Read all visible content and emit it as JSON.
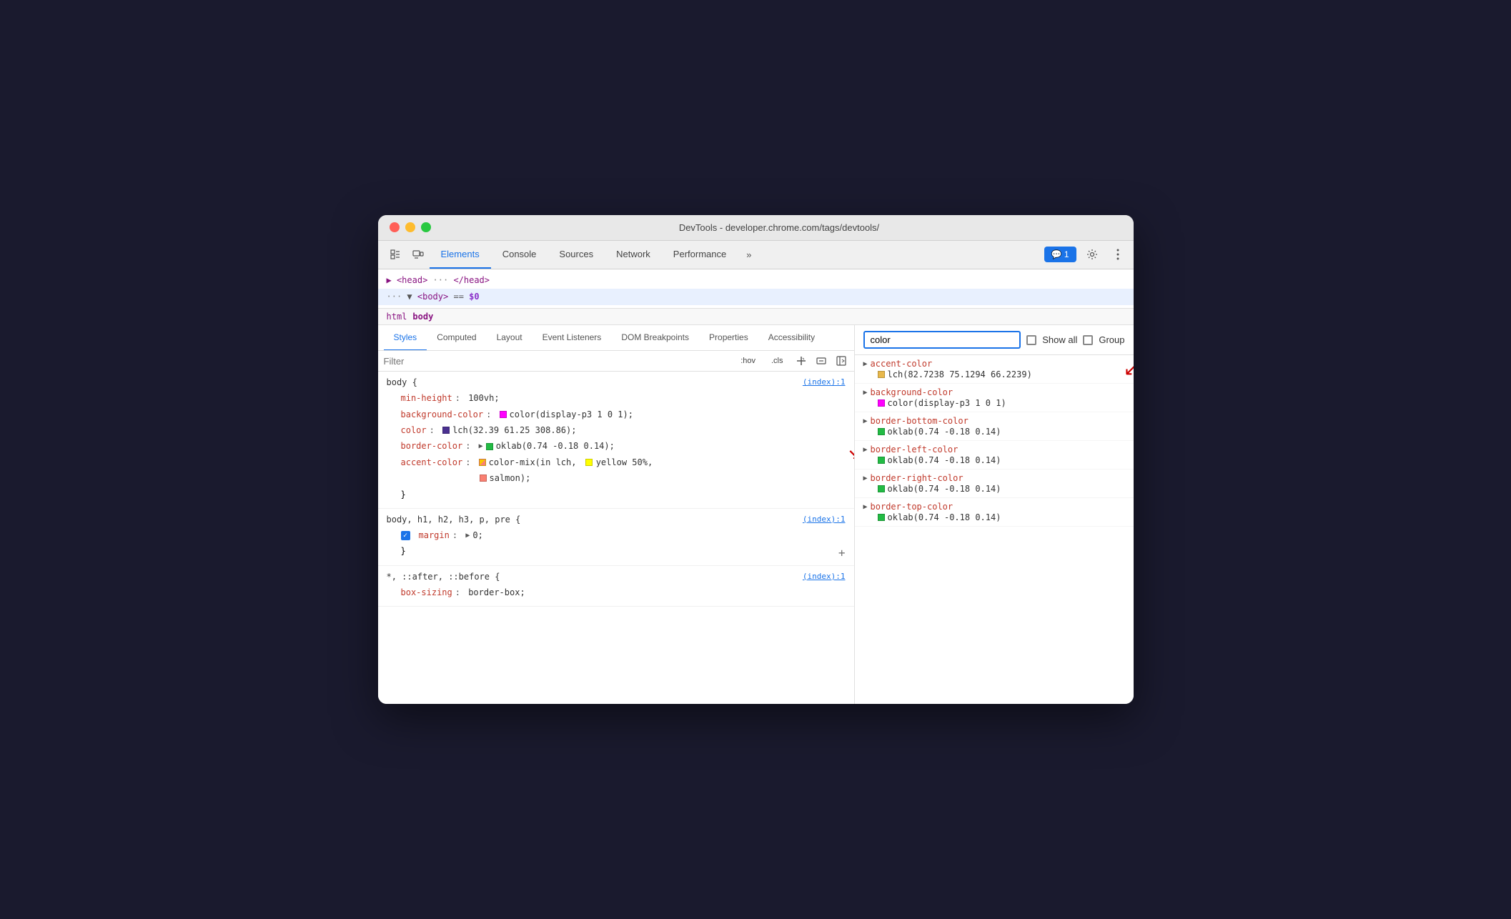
{
  "window": {
    "title": "DevTools - developer.chrome.com/tags/devtools/"
  },
  "tabs": {
    "main": [
      {
        "label": "Elements",
        "active": true
      },
      {
        "label": "Console",
        "active": false
      },
      {
        "label": "Sources",
        "active": false
      },
      {
        "label": "Network",
        "active": false
      },
      {
        "label": "Performance",
        "active": false
      },
      {
        "label": "»",
        "active": false
      }
    ],
    "notification": "💬 1",
    "sub": [
      {
        "label": "Styles",
        "active": true
      },
      {
        "label": "Computed",
        "active": false
      },
      {
        "label": "Layout",
        "active": false
      },
      {
        "label": "Event Listeners",
        "active": false
      },
      {
        "label": "DOM Breakpoints",
        "active": false
      },
      {
        "label": "Properties",
        "active": false
      },
      {
        "label": "Accessibility",
        "active": false
      }
    ]
  },
  "dom": {
    "head_line": "▶ <head> ··· </head>",
    "body_line": "··· ▼ <body> == $0"
  },
  "breadcrumb": {
    "items": [
      "html",
      "body"
    ]
  },
  "filter": {
    "placeholder": "Filter",
    "hov_label": ":hov",
    "cls_label": ".cls"
  },
  "computed_search": {
    "placeholder": "color",
    "value": "color",
    "show_all_label": "Show all",
    "group_label": "Group"
  },
  "css_rules": [
    {
      "selector": "body {",
      "source": "(index):1",
      "properties": [
        {
          "name": "min-height",
          "value": "100vh;",
          "swatch": null
        },
        {
          "name": "background-color",
          "value": "color(display-p3 1 0 1);",
          "swatch": "#ff00ff",
          "swatch_type": "square"
        },
        {
          "name": "color",
          "value": "lch(32.39 61.25 308.86);",
          "swatch": "#5533aa",
          "swatch_type": "square"
        },
        {
          "name": "border-color",
          "value": "oklab(0.74 -0.18 0.14);",
          "swatch": "#33cc44",
          "swatch_type": "expand_square",
          "has_arrow": true
        },
        {
          "name": "accent-color",
          "value": "color-mix(in lch, yellow 50%, salmon);",
          "swatch": "gradient",
          "swatch_type": "gradient"
        }
      ],
      "close": "}"
    },
    {
      "selector": "body, h1, h2, h3, p, pre {",
      "source": "(index):1",
      "properties": [
        {
          "name": "margin",
          "value": "▶ 0;",
          "swatch": null,
          "has_checkbox": true
        }
      ],
      "close": "}"
    },
    {
      "selector": "*, ::after, ::before {",
      "source": "(index):1",
      "properties": [
        {
          "name": "box-sizing",
          "value": "border-box;",
          "swatch": null
        }
      ]
    }
  ],
  "computed_items": [
    {
      "prop": "accent-color",
      "value": "lch(82.7238 75.1294 66.2239)",
      "swatch": "#e8b84b",
      "has_arrow": true,
      "annotation_arrow": true
    },
    {
      "prop": "background-color",
      "value": "color(display-p3 1 0 1)",
      "swatch": "#ff00ff",
      "has_arrow": false
    },
    {
      "prop": "border-bottom-color",
      "value": "oklab(0.74 -0.18 0.14)",
      "swatch": "#33cc44",
      "has_arrow": false
    },
    {
      "prop": "border-left-color",
      "value": "oklab(0.74 -0.18 0.14)",
      "swatch": "#33cc44",
      "has_arrow": false
    },
    {
      "prop": "border-right-color",
      "value": "oklab(0.74 -0.18 0.14)",
      "swatch": "#33cc44",
      "has_arrow": false
    },
    {
      "prop": "border-top-color",
      "value": "oklab(0.74 -0.18 0.14)",
      "swatch": "#33cc44",
      "has_arrow": false
    }
  ]
}
